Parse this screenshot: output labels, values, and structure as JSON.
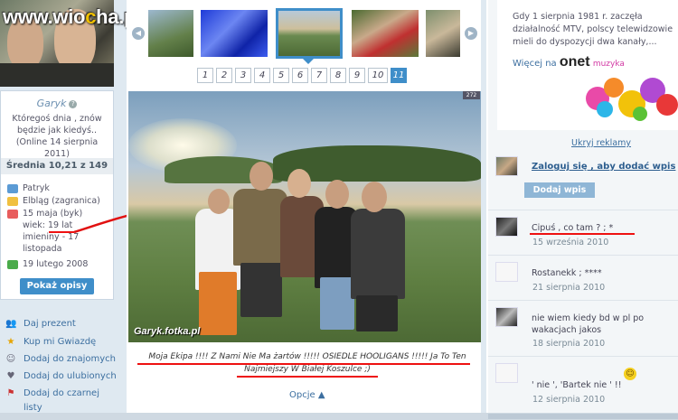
{
  "site": {
    "watermark_pre": "www.wio",
    "watermark_c": "c",
    "watermark_post": "ha.pl"
  },
  "profile": {
    "username": "Garyk",
    "help_icon": "question-icon",
    "motto": "Któregoś dnia , znów będzie jak kiedyś..",
    "online": "(Online 14 sierpnia 2011)",
    "average": "Średnia 10,21 z 149",
    "info": [
      {
        "icon": "person-icon",
        "color": "#5b9bd5",
        "text": "Patryk"
      },
      {
        "icon": "folder-icon",
        "color": "#f0c040",
        "text": "Elbląg (zagranica)"
      },
      {
        "icon": "birthday-icon",
        "color": "#e85d5d",
        "text": "15 maja (byk)"
      },
      {
        "icon": "",
        "color": "",
        "text": "wiek: 19 lat"
      },
      {
        "icon": "",
        "color": "",
        "text": "imieniny - 17"
      },
      {
        "icon": "",
        "color": "",
        "text": "listopada"
      },
      {
        "icon": "join-date-icon",
        "color": "#4aab4a",
        "text": "19 lutego 2008"
      }
    ],
    "show_desc_button": "Pokaż opisy"
  },
  "side_links": [
    {
      "icon": "gift-icon",
      "glyph": "👥",
      "label": "Daj prezent"
    },
    {
      "icon": "star-icon",
      "glyph": "★",
      "label": "Kup mi Gwiazdę"
    },
    {
      "icon": "add-friend-icon",
      "glyph": "☺",
      "label": "Dodaj do znajomych"
    },
    {
      "icon": "favorite-icon",
      "glyph": "♥",
      "label": "Dodaj do ulubionych"
    },
    {
      "icon": "blacklist-icon",
      "glyph": "⚑",
      "label": "Dodaj do czarnej"
    },
    {
      "icon": "",
      "glyph": "",
      "label": "listy"
    }
  ],
  "gallery": {
    "prev_icon": "chevron-left-icon",
    "next_icon": "chevron-right-icon",
    "pages": [
      "1",
      "2",
      "3",
      "4",
      "5",
      "6",
      "7",
      "8",
      "9",
      "10",
      "11"
    ],
    "current_page": "11",
    "photo_count": "272",
    "photo_credit": "Garyk.fotka.pl",
    "caption_line1": "Moja Ekipa !!!! Z Nami Nie Ma żartów !!!!! OSIEDLE HOOLIGANS !!!!! Ja To Ten",
    "caption_line2": "Najmiejszy W Białej Koszulce ;)",
    "options": "Opcje ▲"
  },
  "ad": {
    "text": "Gdy 1 sierpnia 1981 r. zaczęła działalność MTV, polscy telewidzowie mieli do dyspozycji dwa kanały,...",
    "more_label": "Więcej na",
    "brand": "onet",
    "brand_suffix": "muzyka",
    "hide_ads": "Ukryj reklamy"
  },
  "guestbook": {
    "login_prompt": "Zaloguj się , aby dodać wpis",
    "add_button": "Dodaj wpis",
    "entries": [
      {
        "text": "Cipuś , co tam ? ; *",
        "date": "15 września 2010"
      },
      {
        "text": "Rostanekk ; ****",
        "date": "21 sierpnia 2010"
      },
      {
        "text": "nie wiem kiedy bd w pl po wakacjach jakos",
        "date": "18 sierpnia 2010"
      },
      {
        "text": "' nie ', 'Bartek nie ' !!",
        "date": "12 sierpnia 2010"
      }
    ]
  },
  "colors": {
    "accent": "#3f8ec9",
    "annotation_red": "#e11111"
  }
}
